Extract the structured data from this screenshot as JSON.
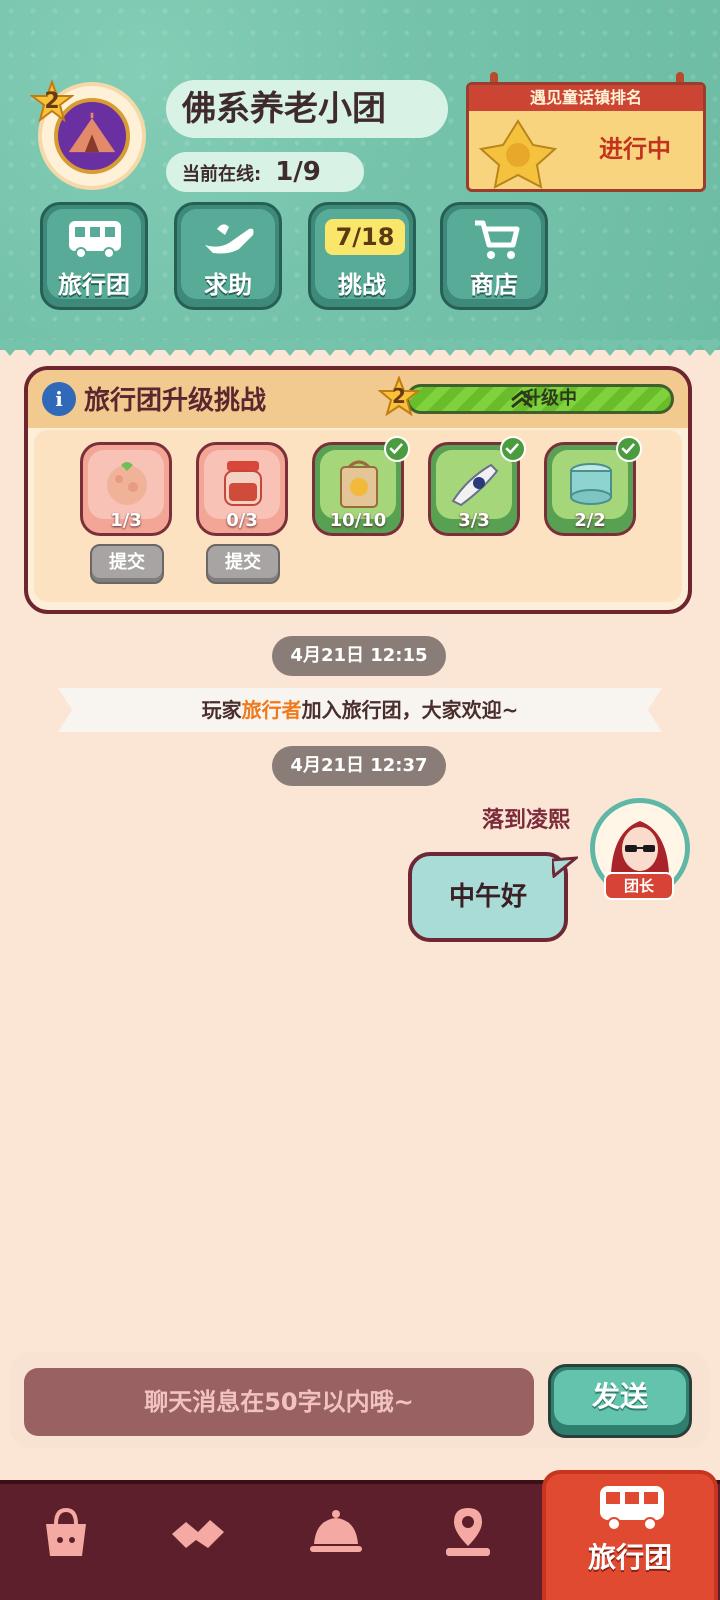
{
  "header": {
    "team_level": "2",
    "team_name": "佛系养老小团",
    "online_label": "当前在线:",
    "online_value": "1/9",
    "ranking": {
      "title": "遇见童话镇排名",
      "status": "进行中"
    }
  },
  "nav": [
    {
      "label": "旅行团",
      "icon": "bus-icon"
    },
    {
      "label": "求助",
      "icon": "hand-icon"
    },
    {
      "label": "挑战",
      "icon": "challenge-icon",
      "badge": "7/18"
    },
    {
      "label": "商店",
      "icon": "cart-icon"
    }
  ],
  "challenge": {
    "title": "旅行团升级挑战",
    "level": "2",
    "progress_label": "升级中",
    "progress_fraction": 1.0,
    "items": [
      {
        "name": "fish-ball-icon",
        "count": "1/3",
        "done": false,
        "submit": "提交"
      },
      {
        "name": "jam-jar-icon",
        "count": "0/3",
        "done": false,
        "submit": "提交"
      },
      {
        "name": "paper-bag-icon",
        "count": "10/10",
        "done": true
      },
      {
        "name": "fish-icon",
        "count": "3/3",
        "done": true
      },
      {
        "name": "cream-jar-icon",
        "count": "2/2",
        "done": true
      }
    ]
  },
  "chat": {
    "time1": "4月21日 12:15",
    "system_prefix": "玩家",
    "system_player": "旅行者",
    "system_suffix": "加入旅行团，大家欢迎~",
    "time2": "4月21日 12:37",
    "sender": "落到凌熙",
    "sender_badge": "团长",
    "message": "中午好"
  },
  "input": {
    "placeholder": "聊天消息在50字以内哦~",
    "send_label": "发送"
  },
  "tabs": [
    {
      "icon": "bag-icon"
    },
    {
      "icon": "handshake-icon"
    },
    {
      "icon": "service-bell-icon"
    },
    {
      "icon": "map-pin-icon"
    },
    {
      "icon": "bus-icon",
      "label": "旅行团",
      "active": true
    }
  ],
  "colors": {
    "header_bg": "#76c3ab",
    "page_bg": "#fbe6d6",
    "accent_red": "#e04a30",
    "tabbar_bg": "#5c1f2b"
  }
}
